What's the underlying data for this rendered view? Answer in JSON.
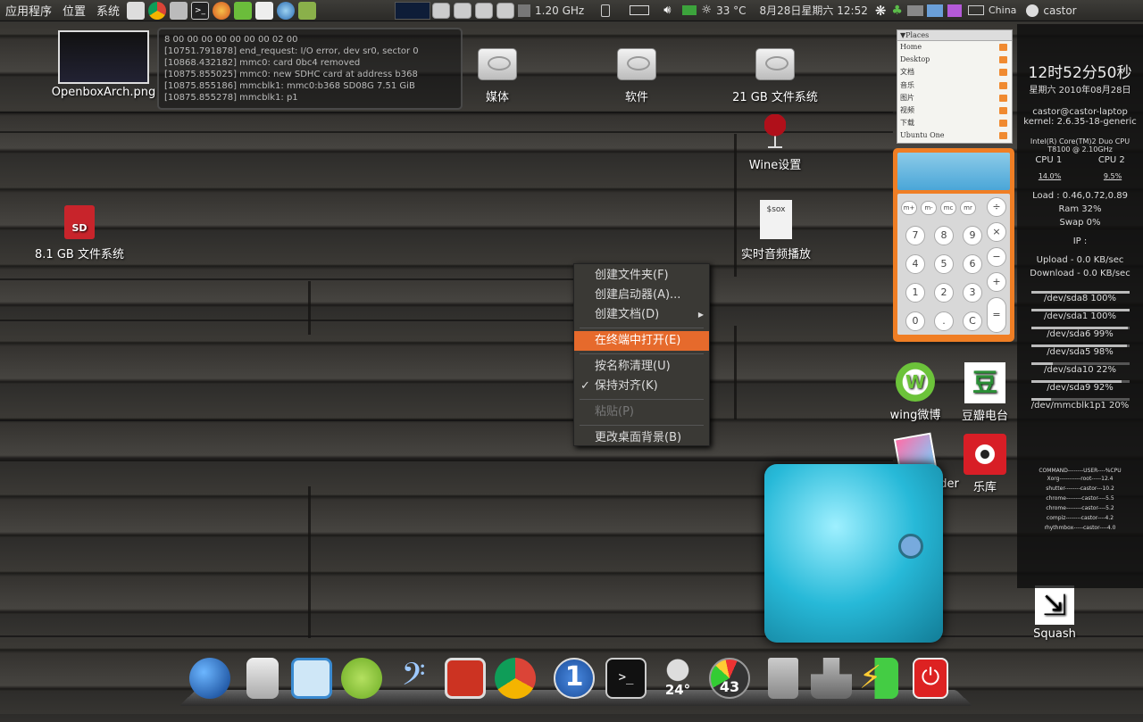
{
  "top_panel": {
    "menus": [
      "应用程序",
      "位置",
      "系统"
    ],
    "cpu_freq": "1.20 GHz",
    "temperature": "33 °C",
    "datetime": "8月28日星期六 12:52",
    "keyboard_layout": "China",
    "username": "castor"
  },
  "desktop_icons": {
    "screenshot": "OpenboxArch.png",
    "media": "媒体",
    "software": "软件",
    "fs21": "21 GB 文件系统",
    "wine": "Wine设置",
    "sd_card": "8.1 GB 文件系统",
    "sox": "实时音频播放",
    "sox_label": "$sox",
    "wing": "wing微博",
    "douban": "豆瓣电台",
    "flickr": "Flickr Uploader",
    "leku": "乐库",
    "squash": "Squash"
  },
  "log_lines": [
    "8 00 00 00 00 00 00 00 02 00",
    "[10751.791878] end_request: I/O error, dev sr0, sector 0",
    "[10868.432182] mmc0: card 0bc4 removed",
    "[10875.855025] mmc0: new SDHC card at address b368",
    "[10875.855186] mmcblk1: mmc0:b368 SD08G 7.51 GiB",
    "[10875.855278]  mmcblk1: p1"
  ],
  "context_menu": {
    "items": [
      "创建文件夹(F)",
      "创建启动器(A)...",
      "创建文档(D)",
      "在终端中打开(E)",
      "按名称清理(U)",
      "保持对齐(K)",
      "粘贴(P)",
      "更改桌面背景(B)"
    ]
  },
  "places": {
    "header": "▼Places",
    "items": [
      "Home",
      "Desktop",
      "文档",
      "音乐",
      "图片",
      "视频",
      "下载",
      "Ubuntu One"
    ]
  },
  "calculator": {
    "keys": [
      "m+",
      "m-",
      "mc",
      "mr",
      "÷",
      "7",
      "8",
      "9",
      "×",
      "4",
      "5",
      "6",
      "−",
      "1",
      "2",
      "3",
      "+",
      "0",
      ".",
      "C",
      "="
    ]
  },
  "sysmon": {
    "clock": "12时52分50秒",
    "date": "星期六 2010年08月28日",
    "user_host": "castor@castor-laptop",
    "kernel": "kernel: 2.6.35-18-generic",
    "cpu_model_1": "Intel(R) Core(TM)2 Duo CPU",
    "cpu_model_2": "T8100  @ 2.10GHz",
    "cpu1_label": "CPU 1",
    "cpu2_label": "CPU 2",
    "cpu1_value": "14.0%",
    "cpu2_value": "9.5%",
    "cpu1_fraction": 0.14,
    "cpu2_fraction": 0.095,
    "load": "Load : 0.46,0.72,0.89",
    "ram": "Ram 32%",
    "swap": "Swap 0%",
    "ram_fraction": 0.32,
    "swap_fraction": 0.0,
    "ip": "IP :",
    "upload": "Upload - 0.0 KB/sec",
    "download": "Download - 0.0 KB/sec",
    "disks": [
      {
        "label": "/dev/sda8 100%",
        "fraction": 1.0
      },
      {
        "label": "/dev/sda1 100%",
        "fraction": 1.0
      },
      {
        "label": "/dev/sda6 99%",
        "fraction": 0.99
      },
      {
        "label": "/dev/sda5 98%",
        "fraction": 0.98
      },
      {
        "label": "/dev/sda10 22%",
        "fraction": 0.22
      },
      {
        "label": "/dev/sda9 92%",
        "fraction": 0.92
      },
      {
        "label": "/dev/mmcblk1p1 20%",
        "fraction": 0.2
      }
    ],
    "process_header": "COMMAND--------USER----%CPU",
    "processes": [
      "Xorg-----------root-----12.4",
      "shutter--------castor---10.2",
      "chrome--------castor----5.5",
      "chrome--------castor----5.2",
      "compiz--------castor----4.2",
      "rhythmbox-----castor----4.0"
    ]
  },
  "dock": {
    "weather_temp": "24°",
    "speed_value": "43",
    "workspace_number": "1",
    "terminal_prompt": ">_"
  },
  "colors": {
    "accent": "#e66a2c",
    "calc_body": "#f07e24",
    "panel": "#3a3935"
  }
}
